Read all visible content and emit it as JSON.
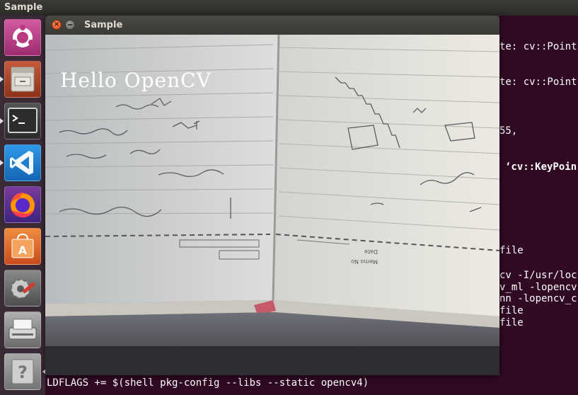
{
  "top_panel": {
    "app_name": "Sample"
  },
  "launcher": {
    "items": [
      {
        "icon": "ubuntu-logo-icon",
        "color": "#c1418c"
      },
      {
        "icon": "file-manager-icon",
        "color": "#b5462a"
      },
      {
        "icon": "terminal-icon",
        "color": "#3c3c3c"
      },
      {
        "icon": "vscode-icon",
        "color": "#1e7fd1"
      },
      {
        "icon": "firefox-icon",
        "color": "#e66000"
      },
      {
        "icon": "software-center-icon",
        "color": "#e9652b"
      },
      {
        "icon": "system-settings-icon",
        "color": "#7a7a7a"
      },
      {
        "icon": "scanner-icon",
        "color": "#8a8a8a"
      },
      {
        "icon": "help-icon",
        "color": "#9a9a9a"
      }
    ]
  },
  "terminal": {
    "lines": [
      "te: cv::Point",
      "te: cv::Point",
      "55,",
      "‘cv::KeyPoin",
      "file",
      "cv -I/usr/loc",
      "v_ml -lopencv",
      "nn -lopencv_c",
      "file",
      "file",
      "LDFLAGS += $(shell pkg-config --libs --static opencv4)"
    ]
  },
  "cv_window": {
    "title": "Sample",
    "overlay_text": "Hello OpenCV"
  },
  "colors": {
    "terminal_bg": "#300a24",
    "close_button": "#df4a16"
  }
}
